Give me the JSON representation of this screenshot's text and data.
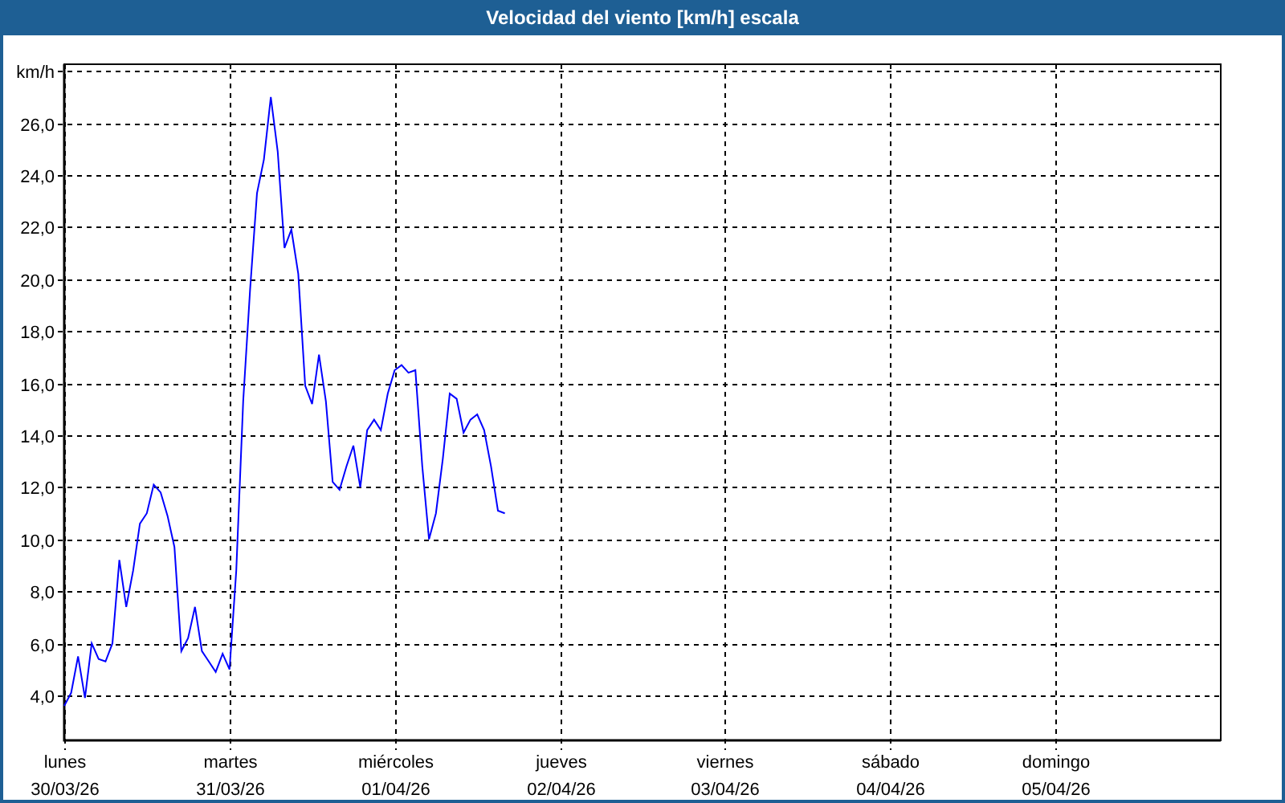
{
  "window": {
    "title": "Velocidad del viento [km/h] escala"
  },
  "chart": {
    "dates": [
      "30/03/26",
      "31/03/26",
      "01/04/26",
      "02/04/26",
      "03/04/26",
      "04/04/26",
      "05/04/26"
    ],
    "chart_data": {
      "type": "line",
      "grid": true,
      "ylim": [
        2.27,
        28.26
      ],
      "categories": [
        "lunes",
        null,
        null,
        null,
        null,
        null,
        null,
        null,
        null,
        null,
        null,
        null,
        null,
        null,
        null,
        null,
        null,
        null,
        null,
        null,
        null,
        null,
        null,
        null,
        "martes",
        null,
        null,
        null,
        null,
        null,
        null,
        null,
        null,
        null,
        null,
        null,
        null,
        null,
        null,
        null,
        null,
        null,
        null,
        null,
        null,
        null,
        null,
        null,
        "miércoles",
        null,
        null,
        null,
        null,
        null,
        null,
        null,
        null,
        null,
        null,
        null,
        null,
        null,
        null,
        null,
        null,
        null,
        null,
        null,
        null,
        null,
        null,
        null,
        "jueves",
        null,
        null,
        null,
        null,
        null,
        null,
        null,
        null,
        null,
        null,
        null,
        null,
        null,
        null,
        null,
        null,
        null,
        null,
        null,
        null,
        null,
        null,
        null,
        "viernes",
        null,
        null,
        null,
        null,
        null,
        null,
        null,
        null,
        null,
        null,
        null,
        null,
        null,
        null,
        null,
        null,
        null,
        null,
        null,
        null,
        null,
        null,
        null,
        "sábado",
        null,
        null,
        null,
        null,
        null,
        null,
        null,
        null,
        null,
        null,
        null,
        null,
        null,
        null,
        null,
        null,
        null,
        null,
        null,
        null,
        null,
        null,
        null,
        "domingo",
        null,
        null,
        null,
        null,
        null,
        null,
        null,
        null,
        null,
        null,
        null,
        null,
        null,
        null,
        null,
        null,
        null,
        null,
        null,
        null,
        null,
        null,
        null
      ],
      "yticks": [
        {
          "value": 4,
          "label": "4,0"
        },
        {
          "value": 6,
          "label": "6,0"
        },
        {
          "value": 8,
          "label": "8,0"
        },
        {
          "value": 10,
          "label": "10,0"
        },
        {
          "value": 12,
          "label": "12,0"
        },
        {
          "value": 14,
          "label": "14,0"
        },
        {
          "value": 16,
          "label": "16,0"
        },
        {
          "value": 18,
          "label": "18,0"
        },
        {
          "value": 20,
          "label": "20,0"
        },
        {
          "value": 22,
          "label": "22,0"
        },
        {
          "value": 24,
          "label": "24,0"
        },
        {
          "value": 26,
          "label": "26,0"
        },
        {
          "value": 28,
          "label": "km/h"
        }
      ],
      "series": [
        {
          "color": "#0000ff",
          "values": [
            3.6,
            4.1,
            5.5,
            3.9,
            6.0,
            5.4,
            5.3,
            6.0,
            9.2,
            7.4,
            8.8,
            10.6,
            11.0,
            12.1,
            11.8,
            10.9,
            9.7,
            5.7,
            6.2,
            7.4,
            5.7,
            5.3,
            4.9,
            5.6,
            5.0,
            8.8,
            15.3,
            19.6,
            23.3,
            24.6,
            27.0,
            24.9,
            21.2,
            21.9,
            20.2,
            15.9,
            15.2,
            17.1,
            15.3,
            12.2,
            11.9,
            12.8,
            13.6,
            12.0,
            14.2,
            14.6,
            14.2,
            15.6,
            16.5,
            16.7,
            16.4,
            16.5,
            12.8,
            10.0,
            11.0,
            13.1,
            15.6,
            15.4,
            14.1,
            14.6,
            14.8,
            14.2,
            12.8,
            11.1,
            11.0,
            null,
            null,
            null,
            null,
            null,
            null,
            null,
            null,
            null,
            null,
            null,
            null,
            null,
            null,
            null,
            null,
            null,
            null,
            null,
            null,
            null,
            null,
            null,
            null,
            null,
            null,
            null,
            null,
            null,
            null,
            null,
            null,
            null,
            null,
            null,
            null,
            null,
            null,
            null,
            null,
            null,
            null,
            null,
            null,
            null,
            null,
            null,
            null,
            null,
            null,
            null,
            null,
            null,
            null,
            null,
            null,
            null,
            null,
            null,
            null,
            null,
            null,
            null,
            null,
            null,
            null,
            null,
            null,
            null,
            null,
            null,
            null,
            null,
            null,
            null,
            null,
            null,
            null,
            null,
            null,
            null,
            null,
            null,
            null,
            null,
            null,
            null,
            null,
            null,
            null,
            null,
            null,
            null,
            null,
            null,
            null,
            null,
            null,
            null,
            null,
            null,
            null,
            null
          ]
        }
      ]
    }
  }
}
